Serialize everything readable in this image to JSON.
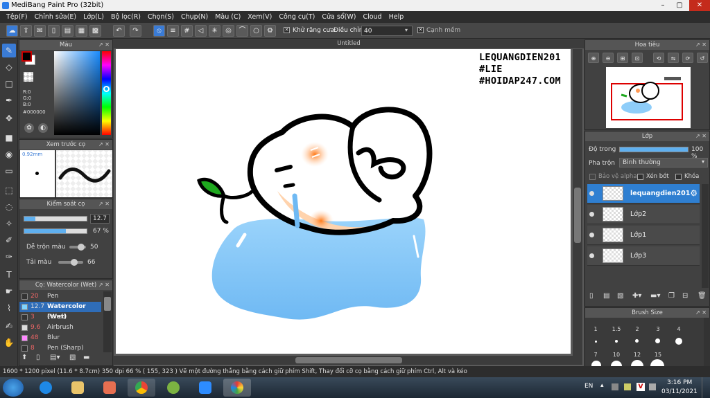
{
  "window": {
    "title": "MediBang Paint Pro (32bit)"
  },
  "menu": [
    "Tệp(F)",
    "Chỉnh sửa(E)",
    "Lớp(L)",
    "Bộ lọc(R)",
    "Chọn(S)",
    "Chụp(N)",
    "Màu (C)",
    "Xem(V)",
    "Công cụ(T)",
    "Cửa sổ(W)",
    "Cloud",
    "Help"
  ],
  "toolbar": {
    "antialias_label": "Khử răng cưa",
    "correction_label": "Điều chỉnh",
    "correction_value": "40",
    "sharp_label": "Cạnh mềm"
  },
  "color_panel": {
    "title": "Màu",
    "r": "R:0",
    "g": "G:0",
    "b": "B:0",
    "hex": "#000000",
    "fg_color": "#000000",
    "bg_color": "#ffffff"
  },
  "preview_panel": {
    "title": "Xem trước cọ",
    "size": "0.92mm"
  },
  "brush_control": {
    "title": "Kiểm soát cọ",
    "size_value": "12.7",
    "opacity_value": "67 %",
    "size_level": 0.18,
    "opacity_level": 0.67,
    "mix_label": "Dễ trộn màu",
    "mix_value": "50",
    "amount_label": "Tải màu",
    "amount_value": "66"
  },
  "brush_panel": {
    "title": "Cọ: Watercolor (Wet)",
    "items": [
      {
        "size": "20",
        "name": "Pen",
        "swatch": "#333333"
      },
      {
        "size": "12.7",
        "name": "Watercolor (Wet)",
        "swatch": "#7fd3ff",
        "selected": true
      },
      {
        "size": "3",
        "name": "Pencil",
        "swatch": "#333333"
      },
      {
        "size": "9.6",
        "name": "Airbrush",
        "swatch": "#dddddd"
      },
      {
        "size": "48",
        "name": "Blur",
        "swatch": "#ff88ff"
      },
      {
        "size": "8",
        "name": "Pen (Sharp)",
        "swatch": "#333333"
      }
    ]
  },
  "canvas": {
    "tab": "Untitled",
    "text_lines": [
      "LEQUANGDIEN201",
      "#LIE",
      "#HOIDAP247.COM"
    ]
  },
  "navigator": {
    "title": "Hoa tiêu"
  },
  "layer_panel": {
    "title": "Lớp",
    "opacity_label": "Độ trong",
    "opacity_value": "100 %",
    "opacity_level": 1.0,
    "blend_label": "Pha trộn",
    "blend_value": "Bình thường",
    "protect_alpha": "Bảo vệ alpha",
    "clipping": "Xén bớt",
    "lock": "Khóa",
    "layers": [
      {
        "name": "lequangdien201",
        "selected": true
      },
      {
        "name": "Lớp2"
      },
      {
        "name": "Lớp1"
      },
      {
        "name": "Lớp3"
      }
    ]
  },
  "brush_size_panel": {
    "title": "Brush Size",
    "row1": [
      "1",
      "1.5",
      "2",
      "3",
      "4"
    ],
    "row2": [
      "7",
      "10",
      "12",
      "15"
    ]
  },
  "status": "1600 * 1200 pixel   (11.6 * 8.7cm)   350 dpi   66 %   ( 155, 323 )   Vẽ một đường thẳng bằng cách giữ phím Shift, Thay đổi cỡ cọ bằng cách giữ phím Ctrl, Alt và kéo",
  "taskbar": {
    "lang": "EN",
    "time": "3:16 PM",
    "date": "03/11/2021"
  }
}
